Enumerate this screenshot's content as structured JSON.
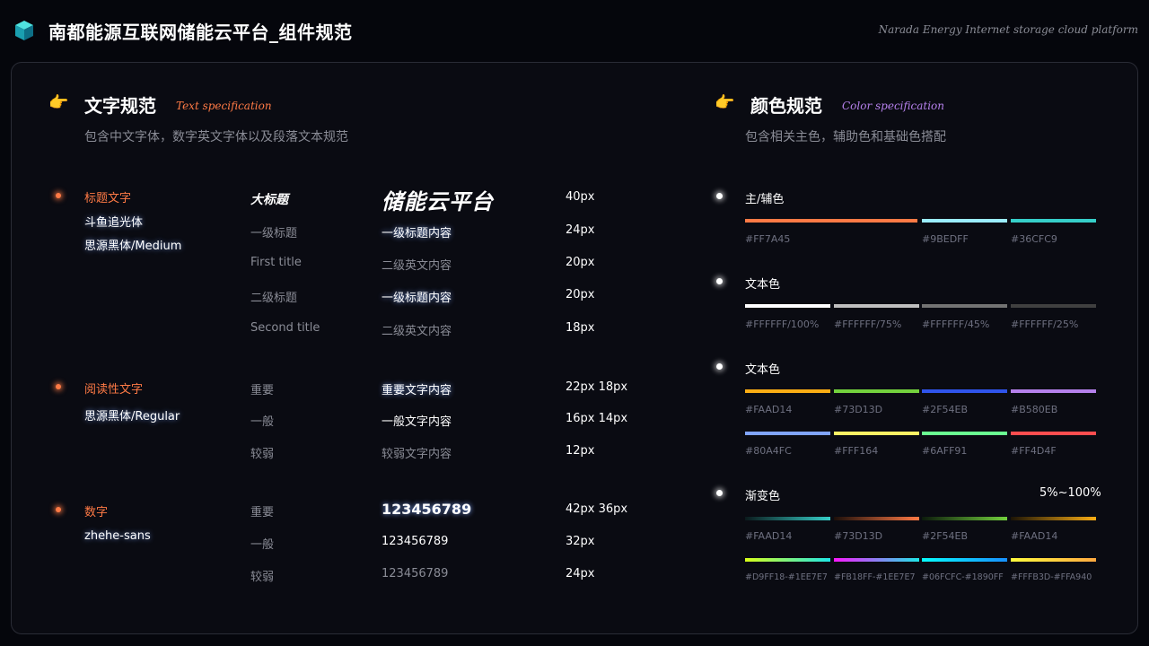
{
  "header": {
    "title": "南都能源互联网储能云平台_组件规范",
    "subtitle": "Narada Energy Internet storage cloud platform"
  },
  "text_spec": {
    "title": "文字规范",
    "title_en": "Text specification",
    "desc": "包含中文字体，数字英文字体以及段落文本规范",
    "groups": [
      {
        "category": "标题文字",
        "fonts": [
          "斗鱼追光体",
          "思源黑体/Medium"
        ],
        "rows": [
          {
            "label": "大标题",
            "sample": "储能云平台",
            "size": "40px"
          },
          {
            "label": "一级标题",
            "sample": "一级标题内容",
            "size": "24px"
          },
          {
            "label": "First title",
            "sample": "二级英文内容",
            "size": "20px"
          },
          {
            "label": "二级标题",
            "sample": "一级标题内容",
            "size": "20px"
          },
          {
            "label": "Second title",
            "sample": "二级英文内容",
            "size": "18px"
          }
        ]
      },
      {
        "category": "阅读性文字",
        "fonts": [
          "思源黑体/Regular"
        ],
        "rows": [
          {
            "label": "重要",
            "sample": "重要文字内容",
            "size": "22px  18px"
          },
          {
            "label": "一般",
            "sample": "一般文字内容",
            "size": "16px  14px"
          },
          {
            "label": "较弱",
            "sample": "较弱文字内容",
            "size": "12px"
          }
        ]
      },
      {
        "category": "数字",
        "fonts": [
          "zhehe-sans"
        ],
        "rows": [
          {
            "label": "重要",
            "sample": "123456789",
            "size": "42px  36px"
          },
          {
            "label": "一般",
            "sample": "123456789",
            "size": "32px"
          },
          {
            "label": "较弱",
            "sample": "123456789",
            "size": "24px"
          }
        ]
      }
    ]
  },
  "color_spec": {
    "title": "颜色规范",
    "title_en": "Color specification",
    "desc": "包含相关主色，辅助色和基础色搭配",
    "groups": [
      {
        "label": "主/辅色",
        "colors": [
          {
            "name": "#FF7A45",
            "color": "#FF7A45"
          },
          {
            "name": "#9BEDFF",
            "color": "#9BEDFF"
          },
          {
            "name": "#36CFC9",
            "color": "#36CFC9"
          }
        ]
      },
      {
        "label": "文本色",
        "colors": [
          {
            "name": "#FFFFFF/100%",
            "color": "#FFFFFF"
          },
          {
            "name": "#FFFFFF/75%",
            "color": "#BFBFBF"
          },
          {
            "name": "#FFFFFF/45%",
            "color": "#737373"
          },
          {
            "name": "#FFFFFF/25%",
            "color": "#404040"
          }
        ]
      },
      {
        "label": "文本色",
        "colors": [
          {
            "name": "#FAAD14",
            "color": "#FAAD14"
          },
          {
            "name": "#73D13D",
            "color": "#73D13D"
          },
          {
            "name": "#2F54EB",
            "color": "#2F54EB"
          },
          {
            "name": "#B580EB",
            "color": "#B580EB"
          },
          {
            "name": "#80A4FC",
            "color": "#80A4FC"
          },
          {
            "name": "#FFF164",
            "color": "#FFF164"
          },
          {
            "name": "#6AFF91",
            "color": "#6AFF91"
          },
          {
            "name": "#FF4D4F",
            "color": "#FF4D4F"
          }
        ]
      },
      {
        "label": "渐变色",
        "note": "5%~100%",
        "colors": [
          {
            "name": "#FAAD14",
            "from": "#0b1a1c",
            "to": "#36CFC9"
          },
          {
            "name": "#73D13D",
            "from": "#1c0f0a",
            "to": "#FF7A45"
          },
          {
            "name": "#2F54EB",
            "from": "#0c1a0c",
            "to": "#73D13D"
          },
          {
            "name": "#FAAD14",
            "from": "#1c1406",
            "to": "#FAAD14"
          },
          {
            "name": "#D9FF18-#1EE7E7",
            "from": "#D9FF18",
            "to": "#1EE7E7"
          },
          {
            "name": "#FB18FF-#1EE7E7",
            "from": "#FB18FF",
            "to": "#1EE7E7"
          },
          {
            "name": "#06FCFC-#1890FF",
            "from": "#06FCFC",
            "to": "#1890FF"
          },
          {
            "name": "#FFFB3D-#FFA940",
            "from": "#FFFB3D",
            "to": "#FFA940"
          }
        ]
      }
    ]
  }
}
